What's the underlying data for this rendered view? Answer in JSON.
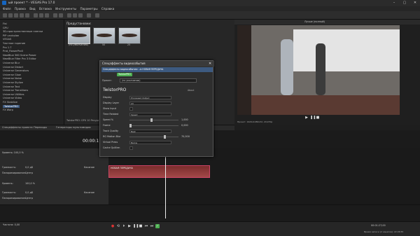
{
  "window": {
    "title": "ый проект * - VEGAS Pro 17.0"
  },
  "menu": [
    "Файл",
    "Правка",
    "Вид",
    "Вставка",
    "Инструменты",
    "Параметры",
    "Справка"
  ],
  "explorer": {
    "items": [
      "Fisi",
      "GPU",
      "3D-пространственные пленки",
      "PiP unvirplan",
      "VEGAS",
      "Частное горение",
      "Pro 1.7",
      "Prat_FlowerPro0",
      "NewBlue 360 Scene Power",
      "NewBlue Filter Pro 3 Editor",
      "Universe Blur",
      "Universe Distort",
      "Universe Generators",
      "Universe Glow",
      "Universe Noise",
      "Universe Stylize",
      "Universe Text",
      "Universe Transitions",
      "Universe Utilities",
      "Universe Video",
      "FX Stabilize",
      "TwistorPRO",
      "FX Warp"
    ],
    "selected_index": 21
  },
  "presets": {
    "header": "Предустановки:",
    "thumbnails": [
      {
        "label": "(по умолчанию)"
      },
      {
        "label": "50"
      },
      {
        "label": "25"
      }
    ]
  },
  "info": {
    "line1": "TwistorPRO: GPU 10 Ресурс...",
    "line2": "TwistorPRO 4.1.1.1"
  },
  "preview": {
    "quality_label": "Лучше (полный)",
    "project_info": "Проект: 1920x1080x32, 29,970p",
    "preview_info": "Предпросмотр: 1920x1080x32, 29,970p",
    "display_info": "Отображение: 531x299x32",
    "frame_label": "Кадр: 2 070",
    "timecode": "00:01:13"
  },
  "bottom_tabs": [
    "Спецэффекты проекта",
    "Переходы",
    "Генераторы мультимедиа",
    "Составные"
  ],
  "dialog": {
    "title": "Спецэффекты видеособытия",
    "fx_chain": "Спецэффекты видеособытия: --b НОВАЯ ПЕРЕДАЧА",
    "chain_badge": "TwistorPRO",
    "preset_label": "Пресет:",
    "preset_value": "(по умолчанию)",
    "plugin_name": "TwistorPRO",
    "about_label": "About",
    "params": [
      {
        "label": "Display",
        "value": "Processed Output"
      },
      {
        "label": "Display Layer",
        "value": "All"
      },
      {
        "label": "Show Input",
        "value": ""
      },
      {
        "label": "Time Related",
        "value": "Speed"
      },
      {
        "label": "Speed %",
        "value": "1,000"
      },
      {
        "label": "Frame",
        "value": "0,000"
      },
      {
        "label": "Track Quality",
        "value": "Best"
      },
      {
        "label": "RG Motion Blur",
        "value": "70,000"
      },
      {
        "label": "Virtual Press",
        "value": "Below"
      },
      {
        "label": "Cache Quillien",
        "value": ""
      }
    ]
  },
  "timeline": {
    "timecode": "00:00:1",
    "track1_name": "Уровень: 100,0 %",
    "clip_label": "НОВАЯ ПЕРЕДАЧА",
    "track2_volume": "Громкость:",
    "track2_volume_val": "0,0 дБ",
    "track2_pan": "Панорамирование:",
    "track2_pan_val": "Центр",
    "track2_mode": "Касание",
    "track3_level": "Уровень:",
    "track3_level_val": "100,0 %",
    "track4_volume": "Громкость:",
    "track4_volume_val": "0,0 дБ",
    "track4_pan": "Панорамирование:",
    "track4_pan_val": "Центр",
    "track4_mode": "Касание",
    "rate_label": "Частота: 0,00",
    "record_time": "Время записи (2 каналов): 22:26:55",
    "position": "00:01:27;00",
    "end": "00:00:05"
  }
}
